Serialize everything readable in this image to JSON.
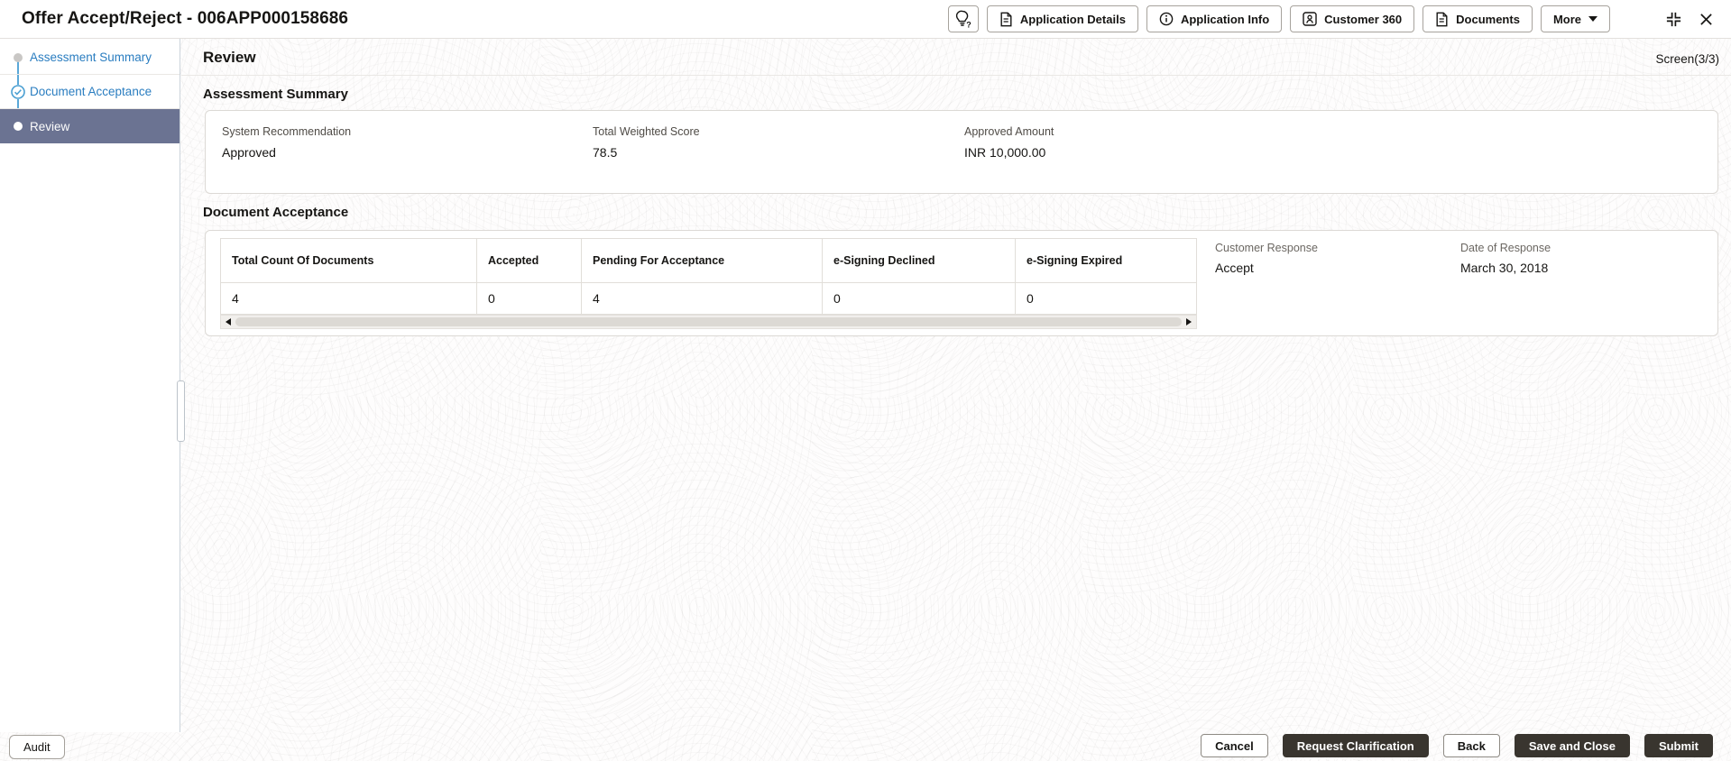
{
  "titlebar": {
    "title": "Offer Accept/Reject - 006APP000158686"
  },
  "toolbar": {
    "help_icon": "lightbulb-question-icon",
    "buttons": [
      {
        "label": "Application Details",
        "icon": "document-icon"
      },
      {
        "label": "Application Info",
        "icon": "info-icon"
      },
      {
        "label": "Customer 360",
        "icon": "person-badge-icon"
      },
      {
        "label": "Documents",
        "icon": "document-icon"
      },
      {
        "label": "More",
        "icon": "caret-down-icon"
      }
    ],
    "window_controls": [
      "collapse-icon",
      "close-icon"
    ]
  },
  "sidebar": {
    "steps": [
      {
        "label": "Assessment Summary",
        "state": "visited"
      },
      {
        "label": "Document Acceptance",
        "state": "completed"
      },
      {
        "label": "Review",
        "state": "active"
      }
    ]
  },
  "main": {
    "page_title": "Review",
    "screen_indicator": "Screen(3/3)",
    "sections": {
      "assessment_summary": {
        "heading": "Assessment Summary",
        "fields": [
          {
            "label": "System Recommendation",
            "value": "Approved"
          },
          {
            "label": "Total Weighted Score",
            "value": "78.5"
          },
          {
            "label": "Approved Amount",
            "value": "INR 10,000.00"
          }
        ]
      },
      "document_acceptance": {
        "heading": "Document Acceptance",
        "table": {
          "columns": [
            "Total Count Of Documents",
            "Accepted",
            "Pending For Acceptance",
            "e-Signing Declined",
            "e-Signing Expired"
          ],
          "row": [
            "4",
            "0",
            "4",
            "0",
            "0"
          ]
        },
        "fields": [
          {
            "label": "Customer Response",
            "value": "Accept"
          },
          {
            "label": "Date of Response",
            "value": "March 30, 2018"
          }
        ]
      }
    }
  },
  "footer": {
    "audit": "Audit",
    "actions": [
      {
        "label": "Cancel",
        "variant": "outline"
      },
      {
        "label": "Request Clarification",
        "variant": "solid"
      },
      {
        "label": "Back",
        "variant": "outline"
      },
      {
        "label": "Save and Close",
        "variant": "solid"
      },
      {
        "label": "Submit",
        "variant": "solid"
      }
    ]
  },
  "colors": {
    "accent_blue": "#2a7dc0",
    "active_step_bg": "#6b7392",
    "dark_button_bg": "#39352f",
    "text_primary": "#161513"
  }
}
